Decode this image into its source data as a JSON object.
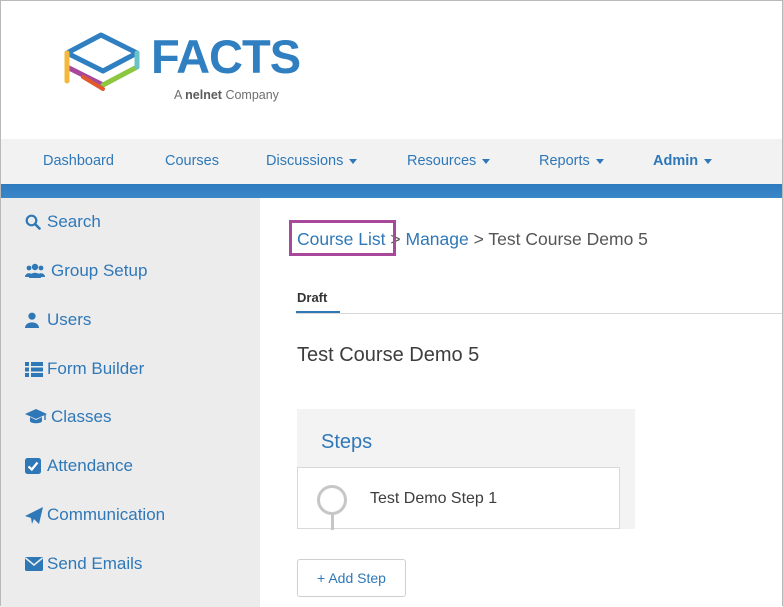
{
  "brand": {
    "name": "FACTS",
    "tagline_prefix": "A",
    "tagline_brand": "nelnet",
    "tagline_suffix": "Company",
    "primary_color": "#2f7fc1"
  },
  "topnav": {
    "items": [
      {
        "label": "Dashboard",
        "has_dropdown": false
      },
      {
        "label": "Courses",
        "has_dropdown": false
      },
      {
        "label": "Discussions",
        "has_dropdown": true
      },
      {
        "label": "Resources",
        "has_dropdown": true
      },
      {
        "label": "Reports",
        "has_dropdown": true
      },
      {
        "label": "Admin",
        "has_dropdown": true
      }
    ]
  },
  "sidebar": {
    "items": [
      {
        "label": "Search",
        "icon": "search-icon"
      },
      {
        "label": "Group Setup",
        "icon": "users-icon"
      },
      {
        "label": "Users",
        "icon": "user-icon"
      },
      {
        "label": "Form Builder",
        "icon": "list-icon"
      },
      {
        "label": "Classes",
        "icon": "graduation-cap-icon"
      },
      {
        "label": "Attendance",
        "icon": "check-square-icon"
      },
      {
        "label": "Communication",
        "icon": "paper-plane-icon"
      },
      {
        "label": "Send Emails",
        "icon": "envelope-icon"
      }
    ]
  },
  "breadcrumb": {
    "items": [
      "Course List",
      "Manage",
      "Test Course Demo 5"
    ],
    "separator": ">",
    "highlight_color": "#a8489b"
  },
  "tabs": {
    "active": "Draft"
  },
  "course": {
    "title": "Test Course Demo 5",
    "steps_heading": "Steps",
    "steps": [
      "Test Demo Step 1"
    ],
    "add_step_label": "+ Add Step"
  }
}
